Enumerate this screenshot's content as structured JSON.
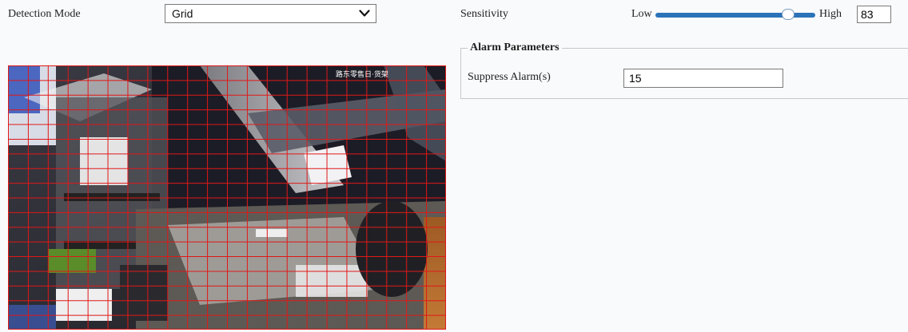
{
  "detection": {
    "label": "Detection Mode",
    "mode_value": "Grid"
  },
  "sensitivity": {
    "label": "Sensitivity",
    "low_label": "Low",
    "high_label": "High",
    "value": "83",
    "level_percent": 83
  },
  "alarm": {
    "legend": "Alarm Parameters",
    "suppress_label": "Suppress Alarm(s)",
    "suppress_value": "15"
  },
  "video": {
    "overlay_text": "路东零售日·货架",
    "grid_color": "#e01818"
  },
  "colors": {
    "slider_track": "#2b73b9",
    "background": "#f9fafc"
  }
}
